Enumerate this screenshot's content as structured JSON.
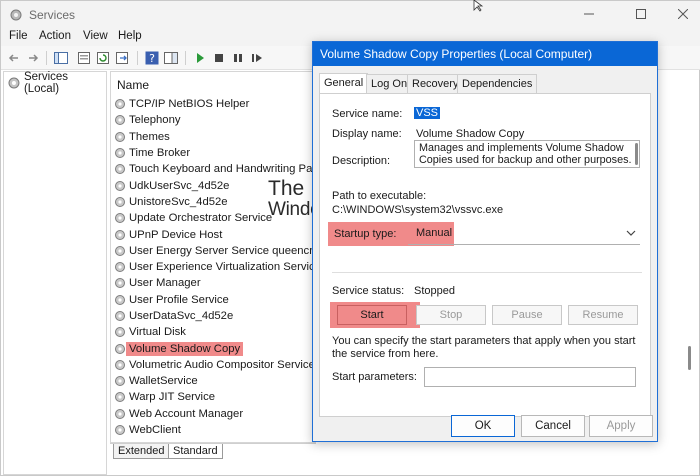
{
  "window": {
    "title": "Services"
  },
  "menu": [
    "File",
    "Action",
    "View",
    "Help"
  ],
  "tree": {
    "root": "Services (Local)"
  },
  "list": {
    "column_name": "Name",
    "services": [
      "TCP/IP NetBIOS Helper",
      "Telephony",
      "Themes",
      "Time Broker",
      "Touch Keyboard and Handwriting Panel S",
      "UdkUserSvc_4d52e",
      "UnistoreSvc_4d52e",
      "Update Orchestrator Service",
      "UPnP Device Host",
      "User Energy Server Service queencreek",
      "User Experience Virtualization Service",
      "User Manager",
      "User Profile Service",
      "UserDataSvc_4d52e",
      "Virtual Disk",
      "Volume Shadow Copy",
      "Volumetric Audio Compositor Service",
      "WalletService",
      "Warp JIT Service",
      "Web Account Manager",
      "WebClient"
    ],
    "selected_index": 15
  },
  "bottom_tabs": [
    "Extended",
    "Standard"
  ],
  "watermark": {
    "line1": "The",
    "line2": "WindowsClub"
  },
  "dialog": {
    "title": "Volume Shadow Copy Properties (Local Computer)",
    "tabs": [
      "General",
      "Log On",
      "Recovery",
      "Dependencies"
    ],
    "service_name_label": "Service name:",
    "service_name": "VSS",
    "display_name_label": "Display name:",
    "display_name": "Volume Shadow Copy",
    "description_label": "Description:",
    "description": "Manages and implements Volume Shadow Copies used for backup and other purposes. If this service is stopped, shadow copies will be unavailable for",
    "path_label": "Path to executable:",
    "path_value": "C:\\WINDOWS\\system32\\vssvc.exe",
    "startup_type_label": "Startup type:",
    "startup_type": "Manual",
    "service_status_label": "Service status:",
    "service_status": "Stopped",
    "buttons": {
      "start": "Start",
      "stop": "Stop",
      "pause": "Pause",
      "resume": "Resume"
    },
    "hint": "You can specify the start parameters that apply when you start the service from here.",
    "start_params_label": "Start parameters:",
    "ok": "OK",
    "cancel": "Cancel",
    "apply": "Apply"
  },
  "colors": {
    "highlight": "#f08a8a",
    "accent": "#0a67d6"
  }
}
